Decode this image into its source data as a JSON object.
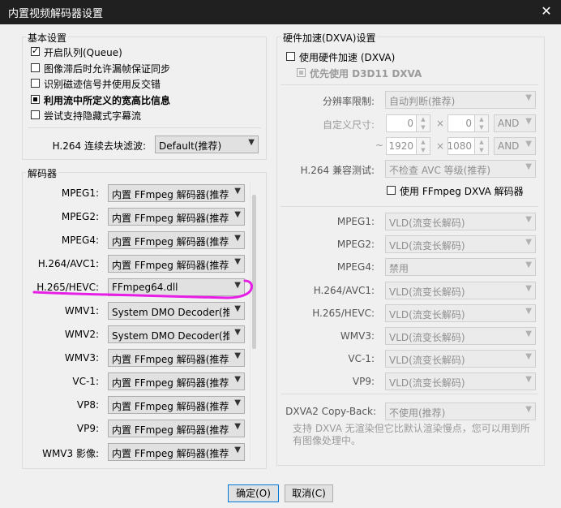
{
  "window": {
    "title": "内置视频解码器设置",
    "close": "✕"
  },
  "basic": {
    "legend": "基本设置",
    "options": [
      {
        "label": "开启队列(Queue)",
        "state": "checked"
      },
      {
        "label": "图像滞后时允许漏帧保证同步",
        "state": "unchecked"
      },
      {
        "label": "识别磁迹信号并使用反交错",
        "state": "unchecked"
      },
      {
        "label": "利用流中所定义的宽高比信息",
        "state": "indeterminate"
      },
      {
        "label": "尝试支持隐藏式字幕流",
        "state": "unchecked"
      }
    ],
    "deblock_label": "H.264 连续去块滤波:",
    "deblock_value": "Default(推荐)"
  },
  "decoders": {
    "legend": "解码器",
    "rows": [
      {
        "name": "MPEG1:",
        "value": "内置 FFmpeg 解码器(推荐)"
      },
      {
        "name": "MPEG2:",
        "value": "内置 FFmpeg 解码器(推荐)"
      },
      {
        "name": "MPEG4:",
        "value": "内置 FFmpeg 解码器(推荐)"
      },
      {
        "name": "H.264/AVC1:",
        "value": "内置 FFmpeg 解码器(推荐)"
      },
      {
        "name": "H.265/HEVC:",
        "value": "FFmpeg64.dll"
      },
      {
        "name": "WMV1:",
        "value": "System DMO Decoder(推荐)"
      },
      {
        "name": "WMV2:",
        "value": "System DMO Decoder(推荐)"
      },
      {
        "name": "WMV3:",
        "value": "内置 FFmpeg 解码器(推荐)"
      },
      {
        "name": "VC-1:",
        "value": "内置 FFmpeg 解码器(推荐)"
      },
      {
        "name": "VP8:",
        "value": "内置 FFmpeg 解码器(推荐)"
      },
      {
        "name": "VP9:",
        "value": "内置 FFmpeg 解码器(推荐)"
      },
      {
        "name": "WMV3 影像:",
        "value": "内置 FFmpeg 解码器(推荐)"
      }
    ]
  },
  "hw": {
    "legend": "硬件加速(DXVA)设置",
    "use_hw": "使用硬件加速 (DXVA)",
    "prefer_d3d11": "优先使用 D3D11 DXVA",
    "resolution_label": "分辨率限制:",
    "resolution_value": "自动判断(推荐)",
    "custom_label": "自定义尺寸:",
    "min_w": "0",
    "min_h": "0",
    "times": "×",
    "and1": "AND",
    "tilde": "~",
    "max_w": "1920",
    "max_h": "1080",
    "and2": "AND",
    "compat_label": "H.264 兼容测试:",
    "compat_value": "不检查 AVC 等级(推荐)",
    "ffmpeg_dxva": "使用 FFmpeg DXVA 解码器",
    "codecs": [
      {
        "name": "MPEG1:",
        "value": "VLD(流变长解码)"
      },
      {
        "name": "MPEG2:",
        "value": "VLD(流变长解码)"
      },
      {
        "name": "MPEG4:",
        "value": "禁用"
      },
      {
        "name": "H.264/AVC1:",
        "value": "VLD(流变长解码)"
      },
      {
        "name": "H.265/HEVC:",
        "value": "VLD(流变长解码)"
      },
      {
        "name": "WMV3:",
        "value": "VLD(流变长解码)"
      },
      {
        "name": "VC-1:",
        "value": "VLD(流变长解码)"
      },
      {
        "name": "VP9:",
        "value": "VLD(流变长解码)"
      }
    ],
    "copyback_label": "DXVA2 Copy-Back:",
    "copyback_value": "不使用(推荐)",
    "note": "支持 DXVA 无渲染但它比默认渲染慢点，您可以用到所有图像处理中。"
  },
  "buttons": {
    "ok": "确定(O)",
    "cancel": "取消(C)"
  },
  "colors": {
    "annotation": "#e61ee6",
    "titlebar": "#202020"
  }
}
